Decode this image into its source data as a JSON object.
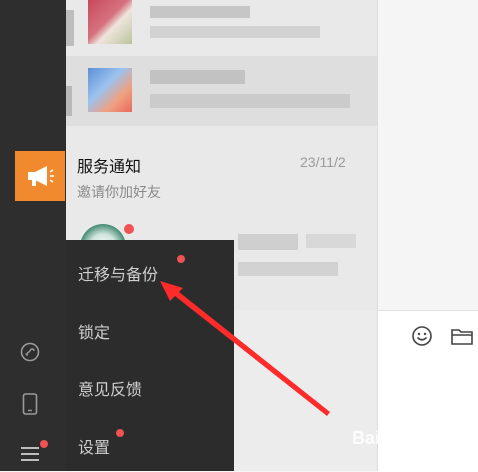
{
  "chat_list": {
    "service_item": {
      "name": "服务通知",
      "date": "23/11/2",
      "subtitle": "邀请你加好友"
    }
  },
  "menu": {
    "items": [
      {
        "label": "迁移与备份",
        "badge": true
      },
      {
        "label": "锁定",
        "badge": false
      },
      {
        "label": "意见反馈",
        "badge": false
      },
      {
        "label": "设置",
        "badge": true
      }
    ]
  },
  "watermark": "Bai 经验",
  "colors": {
    "sidebar_bg": "#2e2e2e",
    "menu_bg": "#2c2c2c",
    "badge": "#f15252",
    "service_avatar": "#f18a2f",
    "arrow": "#ff2a2a"
  },
  "icons": {
    "sidebar": [
      "mini-program-icon",
      "phone-icon",
      "hamburger-menu-icon"
    ],
    "toolbar": [
      "emoji-icon",
      "folder-icon"
    ],
    "service_avatar": "megaphone-icon"
  }
}
